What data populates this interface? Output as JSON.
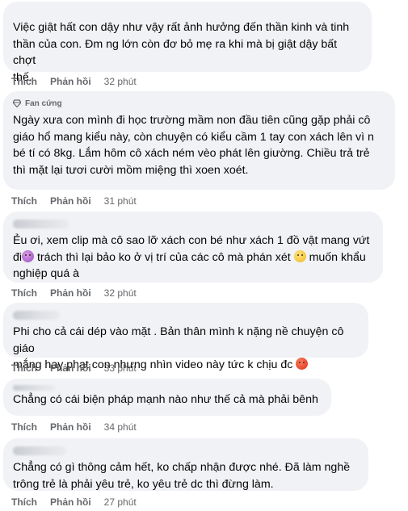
{
  "actions": {
    "like_label": "Thích",
    "reply_label": "Phản hồi"
  },
  "comments": [
    {
      "text": "Việc giật hất con dậy như vậy rất ảnh hưởng đến thần kinh và tinh\nthần của con. Đm ng lớn còn đơ bỏ mẹ ra khi mà bị giật dậy bất chợt\nthế.",
      "time": "32 phút"
    },
    {
      "badge": "Fan cứng",
      "text": "Ngày xưa con mình đi học trường mầm non đầu tiên cũng gặp phải cô\ngiáo hổ mang kiểu này, còn chuyện có kiểu cầm 1 tay con xách lên vì n\nbé tí có 8kg. Lắm hôm cô xách ném vèo phát lên giường. Chiều trả trẻ\nthì mặt lại tươi cười mồm miệng thì xoen xoét.",
      "time": "31 phút"
    },
    {
      "text_parts": [
        "Ẻu ơi, xem clip mà cô sao lỡ xách con bé như xách 1 đồ vật mang vứt\nđi",
        " trách thì lại bảo ko ở vị trí của các cô mà phán xét ",
        " muốn khẩu\nnghiệp quá à"
      ],
      "emojis": [
        "purple-face-emoji",
        "sad-face-emoji"
      ],
      "time": "32 phút"
    },
    {
      "text_parts": [
        "Phi cho cả cái dép vào mặt . Bản thân mình k nặng nề chuyện cô giáo\nmắng hay phạt con nhưng nhìn video này tức k chịu đc "
      ],
      "emojis": [
        "angry-face-emoji"
      ],
      "time": "33 phút"
    },
    {
      "text": "Chẳng có cái biện pháp mạnh nào như thế cả mà phải bênh",
      "time": "34 phút"
    },
    {
      "text": "Chẳng có gì thông cảm hết, ko chấp nhận được nhé. Đã làm nghề\ntrông trẻ là phải yêu trẻ, ko yêu trẻ dc thì đừng làm.",
      "time": "27 phút"
    }
  ]
}
